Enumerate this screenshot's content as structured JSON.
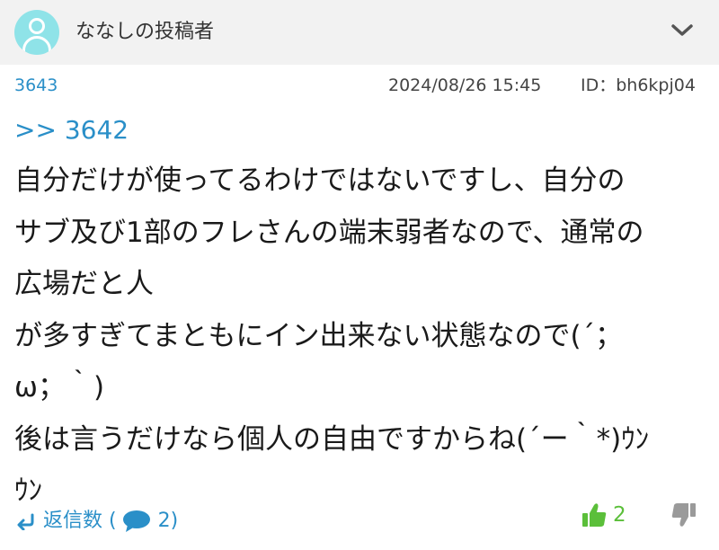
{
  "header": {
    "poster_name": "ななしの投稿者"
  },
  "post": {
    "number": "3643",
    "datetime": "2024/08/26 15:45",
    "id_label": "ID：bh6kpj04",
    "reply_anchor": ">> 3642",
    "body_lines": [
      "自分だけが使ってるわけではないですし、自分の",
      "サブ及び1部のフレさんの端末弱者なので、通常の",
      "広場だと人",
      "が多すぎてまともにイン出来ない状態なので(´；",
      "ω；｀)",
      "後は言うだけなら個人の自由ですからね(´ー｀*)ｳﾝ",
      "ｳﾝ"
    ]
  },
  "footer": {
    "replies_label": "返信数 (",
    "replies_count": "2",
    "replies_close": ")",
    "likes": "2"
  },
  "colors": {
    "accent_blue": "#2a8fc8",
    "like_green": "#5bbf3a",
    "avatar_cyan": "#8fe3e8",
    "header_bg": "#f2f2f2"
  },
  "icons": [
    "user-avatar-icon",
    "chevron-down-icon",
    "reply-arrow-icon",
    "speech-bubble-icon",
    "thumbs-up-icon",
    "thumbs-down-icon"
  ]
}
